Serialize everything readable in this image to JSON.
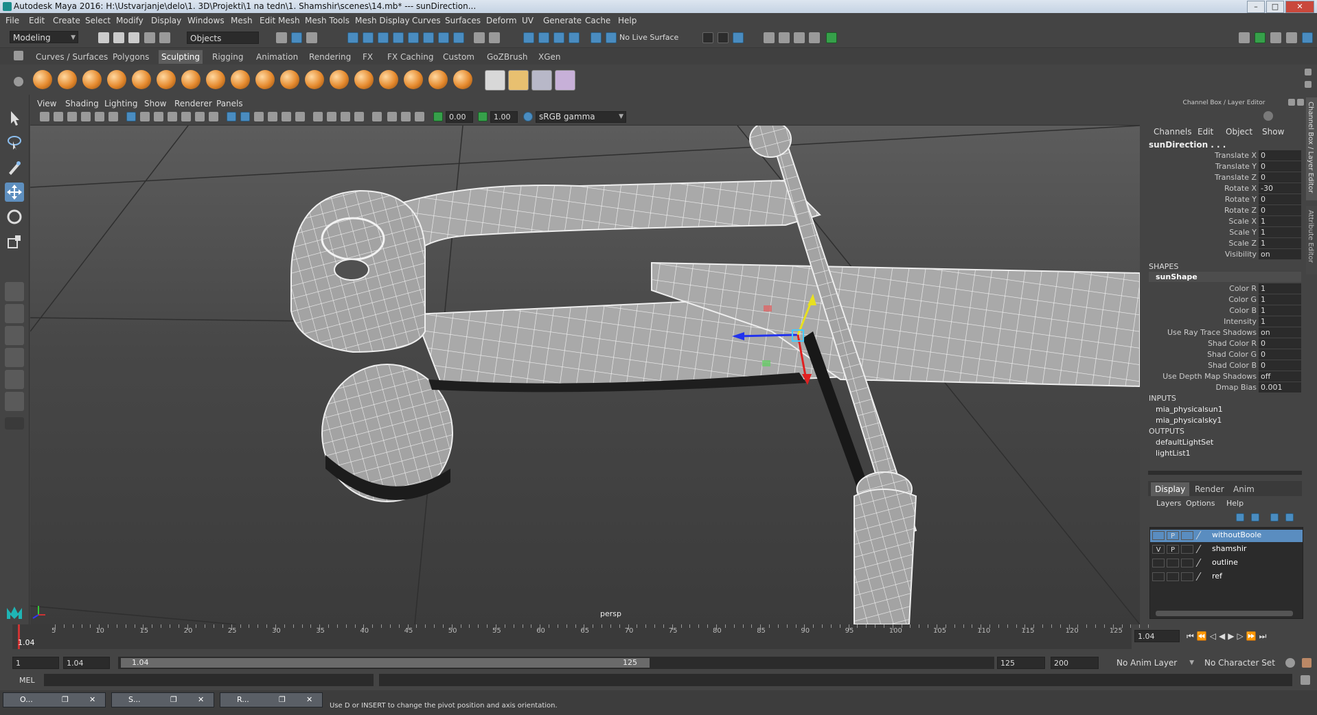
{
  "window": {
    "title": "Autodesk Maya 2016: H:\\Ustvarjanje\\delo\\1. 3D\\Projekti\\1 na tedn\\1. Shamshir\\scenes\\14.mb*   ---   sunDirection...",
    "minimize": "–",
    "maximize": "□",
    "close": "✕"
  },
  "menu": [
    "File",
    "Edit",
    "Create",
    "Select",
    "Modify",
    "Display",
    "Windows",
    "Mesh",
    "Edit Mesh",
    "Mesh Tools",
    "Mesh Display",
    "Curves",
    "Surfaces",
    "Deform",
    "UV",
    "Generate",
    "Cache",
    "Help"
  ],
  "toolbar": {
    "mode": "Modeling",
    "select_mode": "Objects",
    "live_surface": "No Live Surface"
  },
  "shelf_tabs": [
    "Curves / Surfaces",
    "Polygons",
    "Sculpting",
    "Rigging",
    "Animation",
    "Rendering",
    "FX",
    "FX Caching",
    "Custom",
    "GoZBrush",
    "XGen"
  ],
  "shelf_active": "Sculpting",
  "viewport": {
    "menu": [
      "View",
      "Shading",
      "Lighting",
      "Show",
      "Renderer",
      "Panels"
    ],
    "exposure": "0.00",
    "gamma": "1.00",
    "color_space": "sRGB gamma",
    "camera_label": "persp"
  },
  "channel_box": {
    "title": "Channel Box / Layer Editor",
    "tabs": [
      "Channels",
      "Edit",
      "Object",
      "Show"
    ],
    "object_name": "sunDirection . . .",
    "transform": [
      {
        "label": "Translate X",
        "value": "0"
      },
      {
        "label": "Translate Y",
        "value": "0"
      },
      {
        "label": "Translate Z",
        "value": "0"
      },
      {
        "label": "Rotate X",
        "value": "-30"
      },
      {
        "label": "Rotate Y",
        "value": "0"
      },
      {
        "label": "Rotate Z",
        "value": "0"
      },
      {
        "label": "Scale X",
        "value": "1"
      },
      {
        "label": "Scale Y",
        "value": "1"
      },
      {
        "label": "Scale Z",
        "value": "1"
      },
      {
        "label": "Visibility",
        "value": "on"
      }
    ],
    "shapes_header": "SHAPES",
    "shape_name": "sunShape",
    "shape_attrs": [
      {
        "label": "Color R",
        "value": "1"
      },
      {
        "label": "Color G",
        "value": "1"
      },
      {
        "label": "Color B",
        "value": "1"
      },
      {
        "label": "Intensity",
        "value": "1"
      },
      {
        "label": "Use Ray Trace Shadows",
        "value": "on"
      },
      {
        "label": "Shad Color R",
        "value": "0"
      },
      {
        "label": "Shad Color G",
        "value": "0"
      },
      {
        "label": "Shad Color B",
        "value": "0"
      },
      {
        "label": "Use Depth Map Shadows",
        "value": "off"
      },
      {
        "label": "Dmap Bias",
        "value": "0.001"
      }
    ],
    "inputs_header": "INPUTS",
    "inputs": [
      "mia_physicalsun1",
      "mia_physicalsky1"
    ],
    "outputs_header": "OUTPUTS",
    "outputs": [
      "defaultLightSet",
      "lightList1"
    ],
    "side_tabs": [
      "Channel Box / Layer Editor",
      "Attribute Editor"
    ]
  },
  "layer_editor": {
    "tabs": [
      "Display",
      "Render",
      "Anim"
    ],
    "active_tab": "Display",
    "menu": [
      "Layers",
      "Options",
      "Help"
    ],
    "layers": [
      {
        "v": "",
        "p": "P",
        "name": "withoutBoole",
        "selected": true
      },
      {
        "v": "V",
        "p": "P",
        "name": "shamshir",
        "selected": false
      },
      {
        "v": "",
        "p": "",
        "name": "outline",
        "selected": false
      },
      {
        "v": "",
        "p": "",
        "name": "ref",
        "selected": false
      }
    ]
  },
  "timeline": {
    "ticks": [
      "5",
      "10",
      "15",
      "20",
      "25",
      "30",
      "35",
      "40",
      "45",
      "50",
      "55",
      "60",
      "65",
      "70",
      "75",
      "80",
      "85",
      "90",
      "95",
      "100",
      "105",
      "110",
      "115",
      "120",
      "125"
    ],
    "current": "1.04",
    "current_field": "1.04"
  },
  "range": {
    "start": "1",
    "playback_start": "1.04",
    "slider_start": "1.04",
    "slider_end": "125",
    "playback_end": "125",
    "end": "200",
    "anim_layer": "No Anim Layer",
    "char_set": "No Character Set"
  },
  "command": {
    "lang": "MEL"
  },
  "status": {
    "help": "Use D or INSERT to change the pivot position and axis orientation.",
    "tasks": [
      "O...",
      "S...",
      "R..."
    ]
  }
}
